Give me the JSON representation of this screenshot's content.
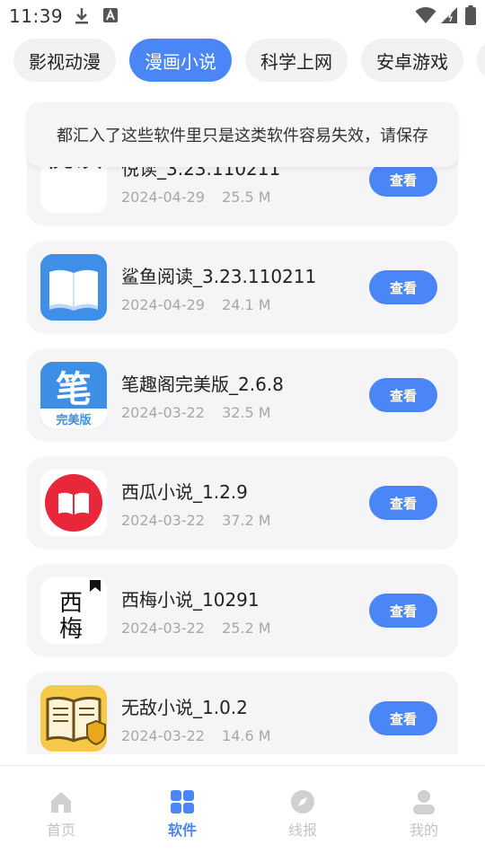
{
  "status_bar": {
    "time": "11:39"
  },
  "tabs": [
    {
      "label": "影视动漫",
      "active": false
    },
    {
      "label": "漫画小说",
      "active": true
    },
    {
      "label": "科学上网",
      "active": false
    },
    {
      "label": "安卓游戏",
      "active": false
    }
  ],
  "notice": {
    "text": "都汇入了这些软件里只是这类软件容易失效，请保存"
  },
  "apps": [
    {
      "name": "悦读_3.23.110211",
      "date": "2024-04-29",
      "size": "25.5 M",
      "action": "查看",
      "icon_text": "悦读"
    },
    {
      "name": "鲨鱼阅读_3.23.110211",
      "date": "2024-04-29",
      "size": "24.1 M",
      "action": "查看"
    },
    {
      "name": "笔趣阁完美版_2.6.8",
      "date": "2024-03-22",
      "size": "32.5 M",
      "action": "查看",
      "icon_text": "笔",
      "icon_subtext": "完美版"
    },
    {
      "name": "西瓜小说_1.2.9",
      "date": "2024-03-22",
      "size": "37.2 M",
      "action": "查看"
    },
    {
      "name": "西梅小说_10291",
      "date": "2024-03-22",
      "size": "25.2 M",
      "action": "查看",
      "icon_text_1": "西",
      "icon_text_2": "梅"
    },
    {
      "name": "无敌小说_1.0.2",
      "date": "2024-03-22",
      "size": "14.6 M",
      "action": "查看"
    }
  ],
  "bottom_nav": [
    {
      "label": "首页",
      "icon": "home-icon",
      "active": false
    },
    {
      "label": "软件",
      "icon": "apps-grid-icon",
      "active": true
    },
    {
      "label": "线报",
      "icon": "compass-icon",
      "active": false
    },
    {
      "label": "我的",
      "icon": "user-icon",
      "active": false
    }
  ],
  "colors": {
    "accent": "#4a86f5",
    "card_bg": "#f5f5f7",
    "meta_text": "#a8a8a8"
  }
}
